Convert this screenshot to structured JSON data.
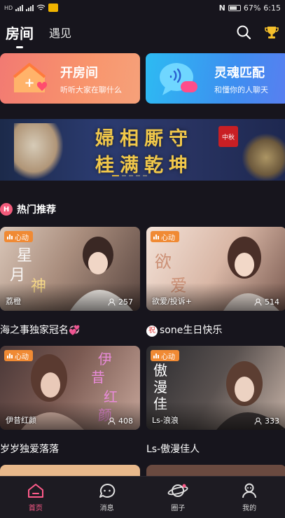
{
  "status_bar": {
    "hd_label": "HD",
    "battery_percent": "67%",
    "nfc_label": "N",
    "time": "6:15"
  },
  "top_tabs": [
    {
      "label": "房间",
      "active": true
    },
    {
      "label": "遇见",
      "active": false
    }
  ],
  "features": [
    {
      "title": "开房间",
      "subtitle": "听听大家在聊什么"
    },
    {
      "title": "灵魂匹配",
      "subtitle": "和懂你的人聊天"
    }
  ],
  "banner": {
    "line1": "婦相厮守",
    "line2": "桂满乾坤",
    "seal": "中秋"
  },
  "section": {
    "icon_letter": "H",
    "title": "热门推荐"
  },
  "rooms": [
    {
      "badge": "心动",
      "host": "荔橙",
      "viewers": "257",
      "title": "海之事独家冠名",
      "title_heart": "💞",
      "title_prefix": ""
    },
    {
      "badge": "心动",
      "host": "欲爱/投诉+",
      "viewers": "514",
      "title": "sone生日快乐",
      "title_heart": "",
      "title_prefix": "祝"
    },
    {
      "badge": "心动",
      "host": "伊昔红颜",
      "viewers": "408",
      "title": "岁岁独爱落落",
      "title_heart": "",
      "title_prefix": ""
    },
    {
      "badge": "心动",
      "host": "Ls-浪浪",
      "viewers": "333",
      "title": "Ls-傲漫佳人",
      "title_heart": "",
      "title_prefix": ""
    }
  ],
  "bottom_nav": [
    {
      "label": "首页",
      "active": true
    },
    {
      "label": "消息",
      "active": false
    },
    {
      "label": "圈子",
      "active": false
    },
    {
      "label": "我的",
      "active": false
    }
  ],
  "colors": {
    "background": "#17151d",
    "accent_pink": "#ff5b8a",
    "badge_orange": "#f08a34",
    "open_room_card": "#f27a72",
    "soul_match_card": "#2dbbf2",
    "banner_gold": "#f0c74a"
  }
}
